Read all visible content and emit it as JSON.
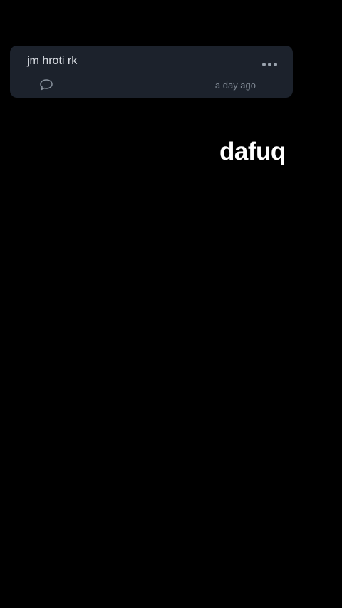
{
  "post": {
    "text": "jm hroti rk",
    "timestamp": "a day ago",
    "comment_icon": "comment-bubble-icon",
    "more_icon": "more-dots-icon"
  },
  "overlay": {
    "caption": "dafuq"
  },
  "colors": {
    "background": "#000000",
    "card": "#1c222c",
    "text": "#d9dde3",
    "muted": "#7f8893"
  }
}
